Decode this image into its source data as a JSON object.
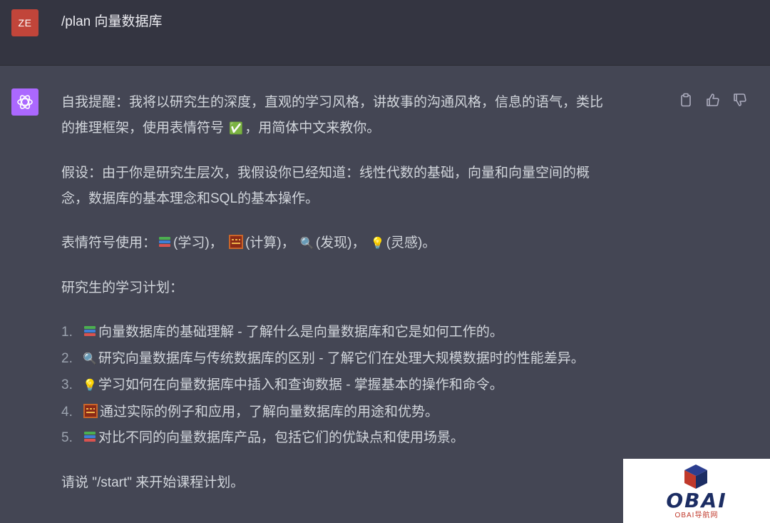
{
  "user": {
    "avatar_initials": "ZE",
    "avatar_color": "#c1453a",
    "message": "/plan 向量数据库"
  },
  "assistant": {
    "avatar_icon": "openai-logo-icon",
    "avatar_color": "#ab68ff",
    "reminder_line1": "自我提醒：我将以研究生的深度，直观的学习风格，讲故事的沟通风格，信息的语气，类比",
    "reminder_line2_a": "的推理框架，使用表情符号",
    "reminder_check": "✅",
    "reminder_line2_b": "，用简体中文来教你。",
    "assumption_line1": "假设：由于你是研究生层次，我假设你已经知道：线性代数的基础，向量和向量空间的概",
    "assumption_line2": "念，数据库的基本理念和SQL的基本操作。",
    "emoji_intro": "表情符号使用：",
    "emoji_legend": [
      {
        "icon": "books-icon",
        "label": "(学习)，"
      },
      {
        "icon": "abacus-icon",
        "label": "(计算)，"
      },
      {
        "icon": "magnifier-icon",
        "label": "(发现)，"
      },
      {
        "icon": "lightbulb-icon",
        "label": "(灵感)。"
      }
    ],
    "plan_heading": "研究生的学习计划：",
    "plan_items": [
      {
        "num": "1.",
        "icon": "books-icon",
        "text": "向量数据库的基础理解 - 了解什么是向量数据库和它是如何工作的。"
      },
      {
        "num": "2.",
        "icon": "magnifier-icon",
        "text": "研究向量数据库与传统数据库的区别 - 了解它们在处理大规模数据时的性能差异。"
      },
      {
        "num": "3.",
        "icon": "lightbulb-icon",
        "text": "学习如何在向量数据库中插入和查询数据 - 掌握基本的操作和命令。"
      },
      {
        "num": "4.",
        "icon": "abacus-icon",
        "text": "通过实际的例子和应用，了解向量数据库的用途和优势。"
      },
      {
        "num": "5.",
        "icon": "books-icon",
        "text": "对比不同的向量数据库产品，包括它们的优缺点和使用场景。"
      }
    ],
    "closing": "请说 \"/start\" 来开始课程计划。"
  },
  "actions": [
    {
      "icon": "clipboard-icon"
    },
    {
      "icon": "thumbs-up-icon"
    },
    {
      "icon": "thumbs-down-icon"
    }
  ],
  "watermark": {
    "logo_text": "OBAI",
    "sub_text": "OBAI导航网",
    "color_primary": "#1c2d63",
    "color_accent": "#c0392b"
  },
  "colors": {
    "user_row_bg": "#343541",
    "assistant_row_bg": "#444654",
    "text": "#d1d5db"
  }
}
